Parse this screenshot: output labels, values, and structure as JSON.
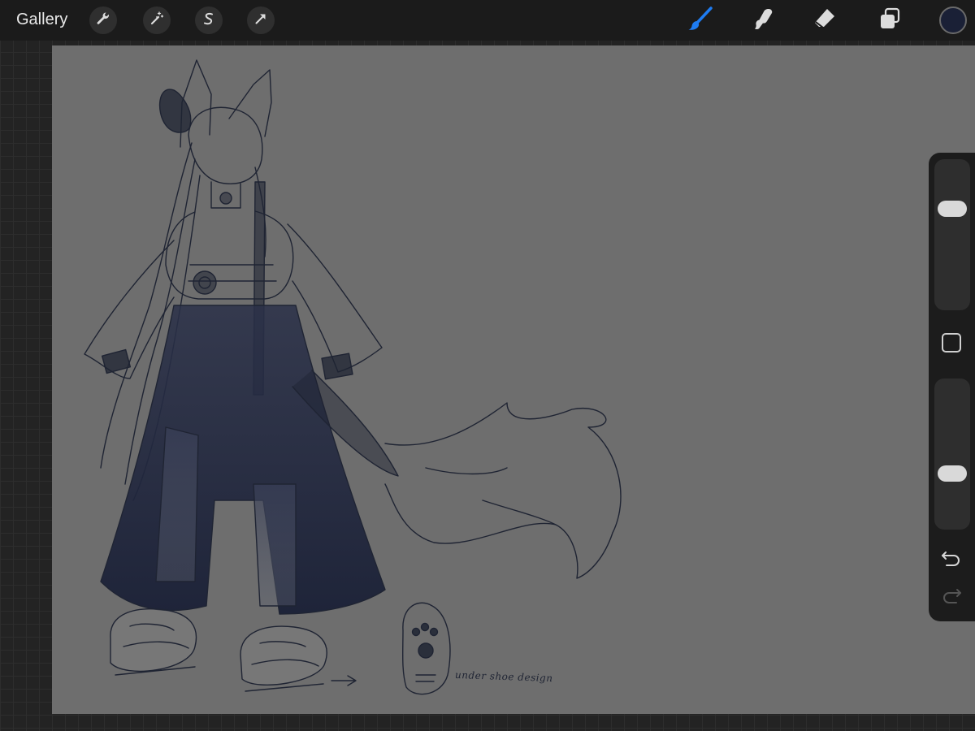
{
  "toolbar": {
    "gallery_label": "Gallery",
    "left_tools": [
      "wrench-icon",
      "magic-wand-icon",
      "selection-icon",
      "transform-arrow-icon"
    ],
    "right_tools": [
      "brush-icon",
      "smudge-icon",
      "eraser-icon",
      "layers-icon"
    ],
    "active_tool": "brush-icon",
    "active_color": "#1a2036",
    "accent_color": "#1e7cf2"
  },
  "canvas": {
    "background_color": "#6e6e6e",
    "ink_color": "#1f2433",
    "annotation_text": "under shoe design"
  },
  "sidebar": {
    "brush_size_level": 0.7,
    "opacity_level": 0.35
  }
}
